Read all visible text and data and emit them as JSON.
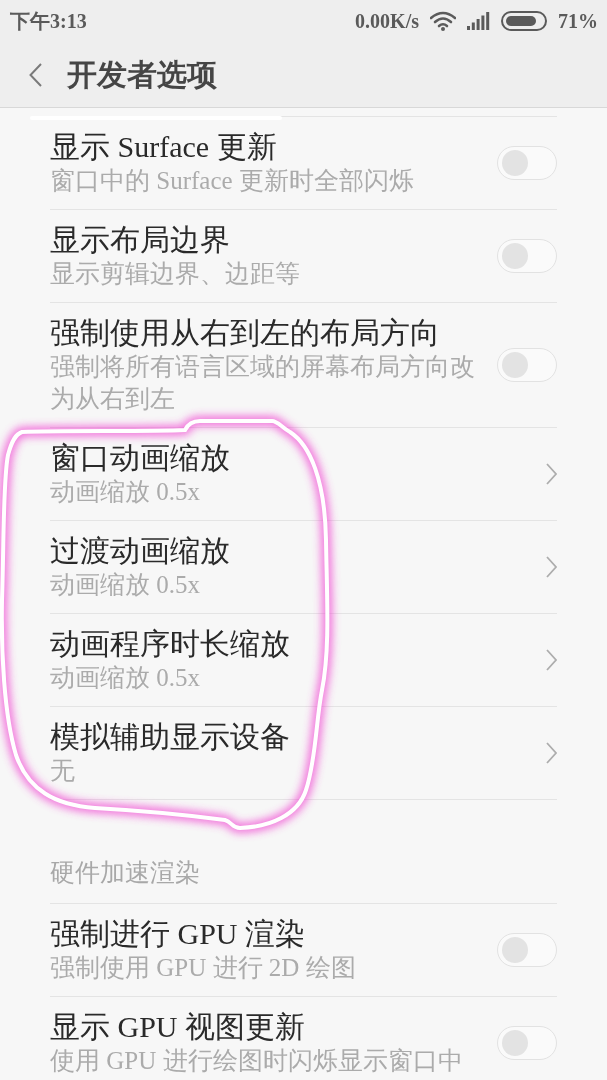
{
  "status_bar": {
    "time": "下午3:13",
    "network_speed": "0.00K/s",
    "battery": "71%"
  },
  "header": {
    "title": "开发者选项"
  },
  "settings": [
    {
      "kind": "toggle",
      "title": "显示 Surface 更新",
      "subtitle": "窗口中的 Surface 更新时全部闪烁",
      "on": false
    },
    {
      "kind": "toggle",
      "title": "显示布局边界",
      "subtitle": "显示剪辑边界、边距等",
      "on": false
    },
    {
      "kind": "toggle",
      "title": "强制使用从右到左的布局方向",
      "subtitle": "强制将所有语言区域的屏幕布局方向改为从右到左",
      "on": false
    },
    {
      "kind": "link",
      "title": "窗口动画缩放",
      "subtitle": "动画缩放 0.5x"
    },
    {
      "kind": "link",
      "title": "过渡动画缩放",
      "subtitle": "动画缩放 0.5x"
    },
    {
      "kind": "link",
      "title": "动画程序时长缩放",
      "subtitle": "动画缩放 0.5x"
    },
    {
      "kind": "link",
      "title": "模拟辅助显示设备",
      "subtitle": "无"
    },
    {
      "kind": "section",
      "title": "硬件加速渲染"
    },
    {
      "kind": "toggle",
      "title": "强制进行 GPU 渲染",
      "subtitle": "强制使用 GPU 进行 2D 绘图",
      "on": false
    },
    {
      "kind": "toggle",
      "title": "显示 GPU 视图更新",
      "subtitle": "使用 GPU 进行绘图时闪烁显示窗口中",
      "on": false
    }
  ]
}
